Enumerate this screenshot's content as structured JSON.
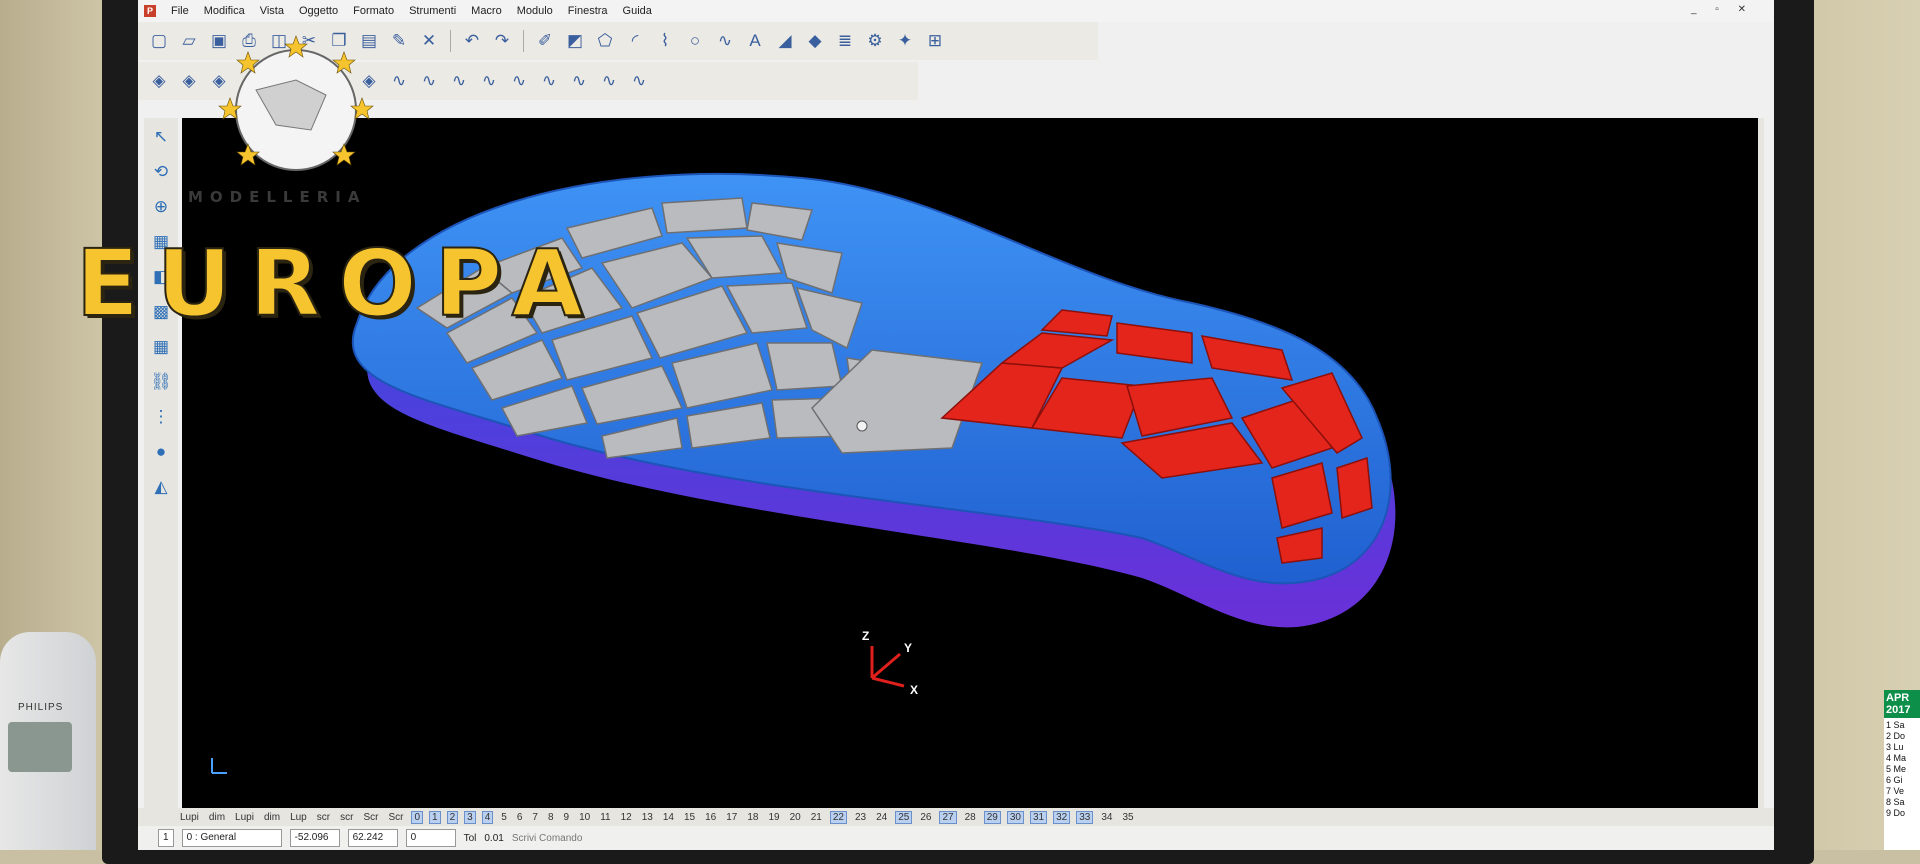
{
  "menu": {
    "items": [
      "File",
      "Modifica",
      "Vista",
      "Oggetto",
      "Formato",
      "Strumenti",
      "Macro",
      "Modulo",
      "Finestra",
      "Guida"
    ]
  },
  "toolbar1_icons": [
    "new-icon",
    "open-icon",
    "save-icon",
    "print-icon",
    "preview-icon",
    "cut-icon",
    "copy-icon",
    "paste-icon",
    "brush-icon",
    "delete-icon",
    "undo-icon",
    "redo-icon",
    "edit-curve-icon",
    "paint-icon",
    "polygon-icon",
    "arc-icon",
    "polyline-icon",
    "circle-icon",
    "spline-icon",
    "text-icon",
    "surface-icon",
    "solid-icon",
    "layers-icon",
    "gears-icon",
    "wand-icon",
    "tree-icon"
  ],
  "toolbar2_icons": [
    "shape1-icon",
    "shape2-icon",
    "shape3-icon",
    "shape4-icon",
    "shape5-icon",
    "shape6-icon",
    "shape7-icon",
    "shape8-icon",
    "curve1-icon",
    "curve2-icon",
    "curve3-icon",
    "curve4-icon",
    "curve5-icon",
    "curve6-icon",
    "curve7-icon",
    "curve8-icon",
    "curve9-icon"
  ],
  "left_tools": [
    "select-arrow-icon",
    "rotate-view-icon",
    "zoom-icon",
    "layer-icon",
    "box-icon",
    "cube-icon",
    "cube-group-icon",
    "chain-icon",
    "grid-icon",
    "sphere-icon",
    "wedge-icon"
  ],
  "right_tools": [
    "view-front-icon",
    "view-side-icon",
    "view-top-icon",
    "view-iso-icon",
    "view-orbit-icon",
    "rotate-left-icon",
    "rotate-right-icon",
    "fit-icon",
    "frame-icon",
    "wire-globe-icon",
    "shaded-sphere-icon",
    "pyramid-icon",
    "light-icon"
  ],
  "axes": {
    "z": "Z",
    "y": "Y",
    "x": "X"
  },
  "statusbar": {
    "labels": [
      "Lupi",
      "dim",
      "Lupi",
      "dim",
      "Lup",
      "scr",
      "scr",
      "Scr",
      "Scr"
    ],
    "numbers": [
      "0",
      "1",
      "2",
      "3",
      "4",
      "5",
      "6",
      "7",
      "8",
      "9",
      "10",
      "11",
      "12",
      "13",
      "14",
      "15",
      "16",
      "17",
      "18",
      "19",
      "20",
      "21",
      "22",
      "23",
      "24",
      "25",
      "26",
      "27",
      "28",
      "29",
      "30",
      "31",
      "32",
      "33",
      "34",
      "35"
    ]
  },
  "cmdbar": {
    "layer": "1",
    "layer_name": "0 : General",
    "coord_x": "-52.096",
    "coord_y": "62.242",
    "coord_z": "0",
    "tol_label": "Tol",
    "tol_value": "0.01",
    "command_placeholder": "Scrivi Comando"
  },
  "phone": {
    "brand": "PHILIPS"
  },
  "calendar": {
    "month": "APR",
    "year": "2017",
    "rows": [
      "1 Sa",
      "2 Do",
      "3 Lu",
      "4 Ma",
      "5 Me",
      "6 Gi",
      "7 Ve",
      "8 Sa",
      "9 Do"
    ]
  },
  "logo": {
    "subtitle": "MODELLERIA",
    "title": "EUROPA"
  },
  "colors": {
    "sole_base": "#2f7fe0",
    "sole_lower": "#5a3be0",
    "tread_gray": "#b7b9bc",
    "tread_red": "#e2241c",
    "viewport": "#000000",
    "logo_gold": "#f6c42e"
  }
}
